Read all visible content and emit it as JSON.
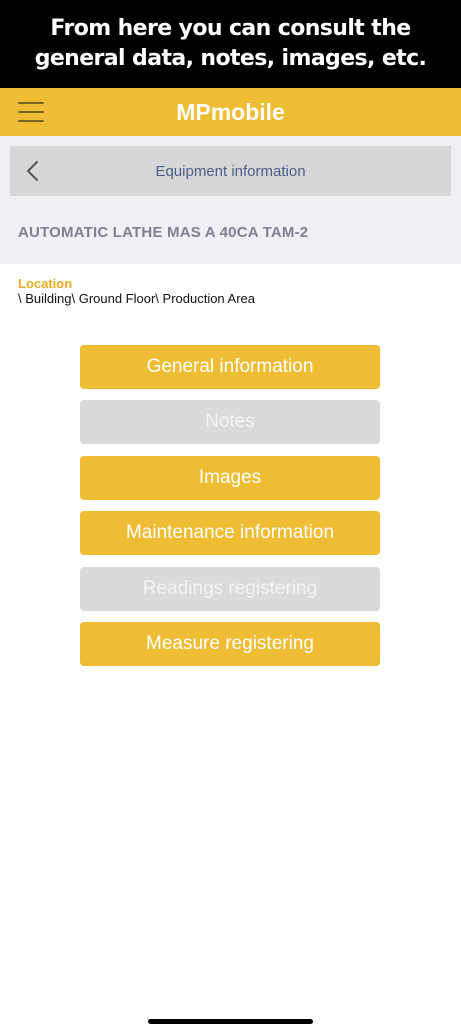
{
  "banner": {
    "line1": "From here you can consult the",
    "line2": "general data, notes, images, etc."
  },
  "appbar": {
    "title": "MPmobile",
    "menu_icon": "hamburger-menu-icon"
  },
  "navbar": {
    "back_icon": "chevron-left-icon",
    "title": "Equipment information"
  },
  "equipment": {
    "name": "AUTOMATIC LATHE MAS A 40CA TAM-2"
  },
  "location": {
    "label": "Location",
    "value": "\\ Building\\ Ground Floor\\ Production Area"
  },
  "actions": [
    {
      "label": "General information",
      "enabled": true
    },
    {
      "label": "Notes",
      "enabled": false
    },
    {
      "label": "Images",
      "enabled": true
    },
    {
      "label": "Maintenance information",
      "enabled": true
    },
    {
      "label": "Readings registering",
      "enabled": false
    },
    {
      "label": "Measure registering",
      "enabled": true
    }
  ],
  "colors": {
    "accent": "#eebd33",
    "disabled": "#dadada",
    "location_label": "#e6ad1e",
    "nav_title": "#4a5f86"
  }
}
